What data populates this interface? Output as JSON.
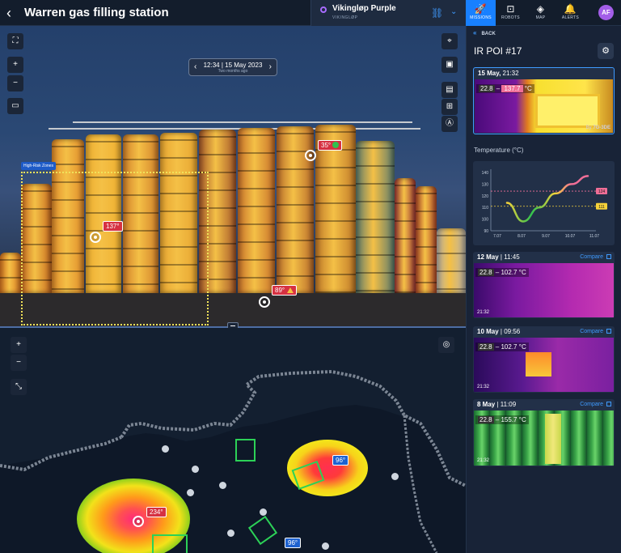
{
  "header": {
    "title": "Warren gas filling station"
  },
  "robot": {
    "name": "Vikingløp Purple",
    "sub": "VIKINGLØP"
  },
  "nav": [
    {
      "label": "MISSIONS",
      "icon": "rocket-icon"
    },
    {
      "label": "ROBOTS",
      "icon": "robot-icon"
    },
    {
      "label": "MAP",
      "icon": "layers-icon"
    },
    {
      "label": "ALERTS",
      "icon": "bell-icon"
    }
  ],
  "user": {
    "initials": "AF"
  },
  "photo": {
    "time": "12:34 | 15 May 2023",
    "ago": "Two months ago",
    "zone_label": "High-Risk Zones",
    "tags": [
      "35°",
      "137°",
      "89°"
    ]
  },
  "map": {
    "tags": [
      "234°",
      "96°",
      "96°"
    ]
  },
  "panel": {
    "back": "BACK",
    "title": "IR POI #17",
    "chart_title": "Temperature (°C)",
    "cards": [
      {
        "date": "15 May,",
        "time": "21:32",
        "low": "22.8",
        "high": "137.7",
        "unit": "°C",
        "by": "By",
        "robot_code": "7G-3DE",
        "compare": ""
      },
      {
        "date": "12 May",
        "time": "11:45",
        "low": "22.8",
        "high": "102.7",
        "unit": "°C",
        "stamp": "21:32",
        "compare": "Compare"
      },
      {
        "date": "10 May",
        "time": "09:56",
        "low": "22.8",
        "high": "102.7",
        "unit": "°C",
        "stamp": "21:32",
        "compare": "Compare"
      },
      {
        "date": "8 May",
        "time": "11:09",
        "low": "22.8",
        "high": "155.7",
        "unit": "°C",
        "stamp": "21:32",
        "compare": "Compare"
      }
    ]
  },
  "chart_data": {
    "type": "line",
    "title": "Temperature (°C)",
    "x": [
      "7.07",
      "8.07",
      "9.07",
      "10.07",
      "11.07"
    ],
    "ylim": [
      90,
      140
    ],
    "yticks": [
      90,
      100,
      110,
      120,
      130,
      140
    ],
    "series": [
      {
        "values": [
          114,
          98,
          110,
          122,
          130,
          137
        ]
      }
    ],
    "thresholds": [
      {
        "value": 124,
        "label": "124",
        "color": "#f06e97"
      },
      {
        "value": 111,
        "label": "111",
        "color": "#f6d23a"
      }
    ]
  }
}
